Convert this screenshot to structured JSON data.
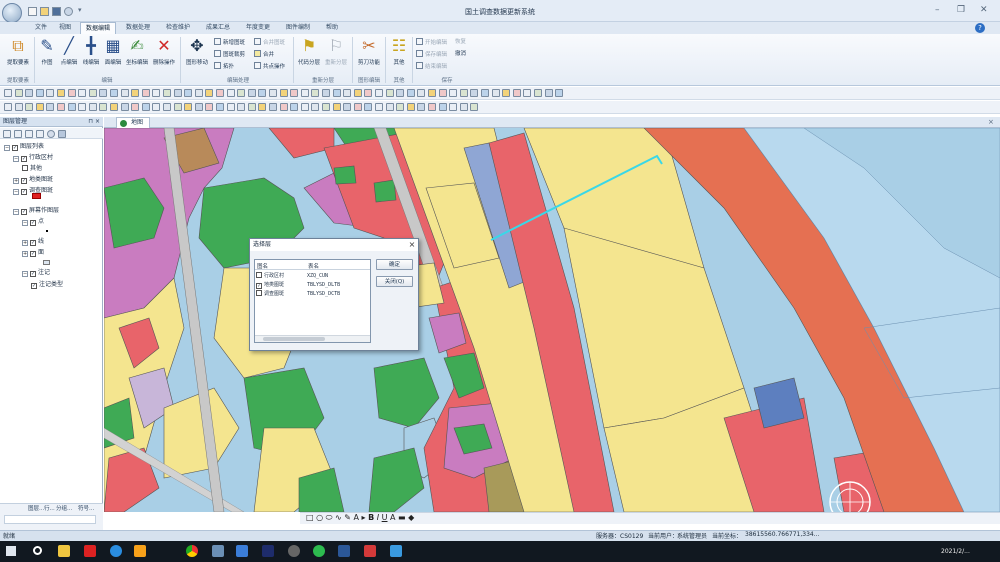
{
  "window": {
    "title": "国土调查数据更新系统",
    "controls": [
      "–",
      "❐",
      "✕"
    ]
  },
  "ribbon_tabs": [
    "文件",
    "视图",
    "数据编辑",
    "数据处理",
    "检查维护",
    "成果汇总",
    "年度变更",
    "图件编制",
    "帮助"
  ],
  "active_tab": "数据编辑",
  "ribbon": {
    "groups": [
      {
        "name": "提取要素",
        "buttons": [
          "提取要素"
        ]
      },
      {
        "name": "编辑",
        "buttons": [
          "作图",
          "点编辑",
          "线编辑",
          "面编辑",
          "坐标编辑",
          "删除操作"
        ]
      },
      {
        "name": "编辑处理",
        "buttons": [
          "图形移动"
        ],
        "small": [
          "新增图斑",
          "合并图斑",
          "图斑裁剪",
          "合并",
          "拓扑",
          "共点操作"
        ]
      },
      {
        "name": "重新分层",
        "buttons": [
          "代码分层",
          "重新分层"
        ]
      },
      {
        "name": "图形编辑",
        "buttons": [
          "剪刀功能"
        ]
      },
      {
        "name": "其他",
        "buttons": [
          "其他"
        ]
      },
      {
        "name": "保存",
        "small": [
          "开始编辑",
          "恢复",
          "保存编辑",
          "撤消",
          "结束编辑"
        ]
      }
    ]
  },
  "layer_panel": {
    "title": "图层管理",
    "pin": "⊓ ×",
    "tree": [
      {
        "label": "图层列表",
        "level": 0,
        "checked": true,
        "expand": "−"
      },
      {
        "label": "行政区村",
        "level": 1,
        "checked": true,
        "expand": "−"
      },
      {
        "label": "其他",
        "level": 2,
        "checked": null,
        "expand": ""
      },
      {
        "label": "地类图斑",
        "level": 1,
        "checked": true,
        "expand": "+"
      },
      {
        "label": "调查图斑",
        "level": 1,
        "checked": true,
        "expand": "−"
      },
      {
        "label": "屏幕作图层",
        "level": 1,
        "checked": true,
        "expand": "−"
      },
      {
        "label": "点",
        "level": 2,
        "checked": true,
        "expand": "−"
      },
      {
        "label": "线",
        "level": 2,
        "checked": true,
        "expand": "+"
      },
      {
        "label": "面",
        "level": 2,
        "checked": true,
        "expand": "+"
      },
      {
        "label": "注记",
        "level": 2,
        "checked": true,
        "expand": "−"
      },
      {
        "label": "注记类型",
        "level": 3,
        "checked": true,
        "expand": ""
      }
    ],
    "bottom_tabs": [
      "图层...",
      "行...",
      "分组...",
      "符号..."
    ]
  },
  "map_tab": {
    "label": "地图"
  },
  "dialog": {
    "title": "选择层",
    "columns": [
      "图名",
      "表名"
    ],
    "rows": [
      {
        "name": "行政区村",
        "table": "XZQ_CUN",
        "checked": false
      },
      {
        "name": "地类图斑",
        "table": "TBLYSD_DLTB",
        "checked": true
      },
      {
        "name": "调查图斑",
        "table": "TBLYSD_DCTB",
        "checked": false
      }
    ],
    "ok": "确定",
    "close": "关闭(Q)"
  },
  "statusbar": {
    "left": "就绪",
    "server": "服务器：CS0129",
    "user": "当前用户：",
    "role": "系统管理员",
    "coord_label": "当前坐标：",
    "coord": "38615560.766771,334..."
  },
  "taskbar": {
    "time": "2021/2/..."
  },
  "colors": {
    "ribbon_bg": "#e6edf6",
    "accent": "#2c6ec4",
    "water": "#a9cfe6",
    "urban": "#e8646a",
    "farmland": "#f4e58f",
    "forest": "#3faa55",
    "road": "#c8c8c8",
    "river": "#e57052",
    "highlight_line": "#39d8e8"
  }
}
